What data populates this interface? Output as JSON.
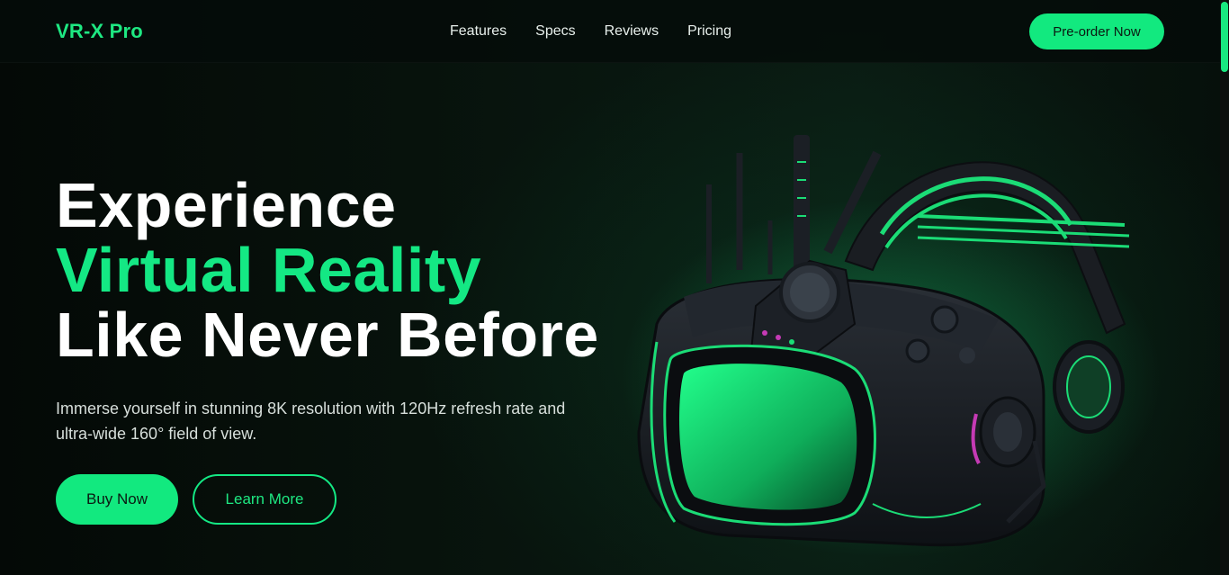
{
  "nav": {
    "logo": "VR-X Pro",
    "links": [
      "Features",
      "Specs",
      "Reviews",
      "Pricing"
    ],
    "cta": "Pre-order Now"
  },
  "hero": {
    "line1": "Experience",
    "line2": "Virtual Reality",
    "line3": "Like Never Before",
    "subtitle": "Immerse yourself in stunning 8K resolution with 120Hz refresh rate and ultra-wide 160° field of view.",
    "primary_button": "Buy Now",
    "secondary_button": "Learn More"
  },
  "colors": {
    "accent": "#14e884",
    "background": "#07110c",
    "text": "#ffffff"
  },
  "icons": {
    "hero_image": "vr-headset-image"
  }
}
